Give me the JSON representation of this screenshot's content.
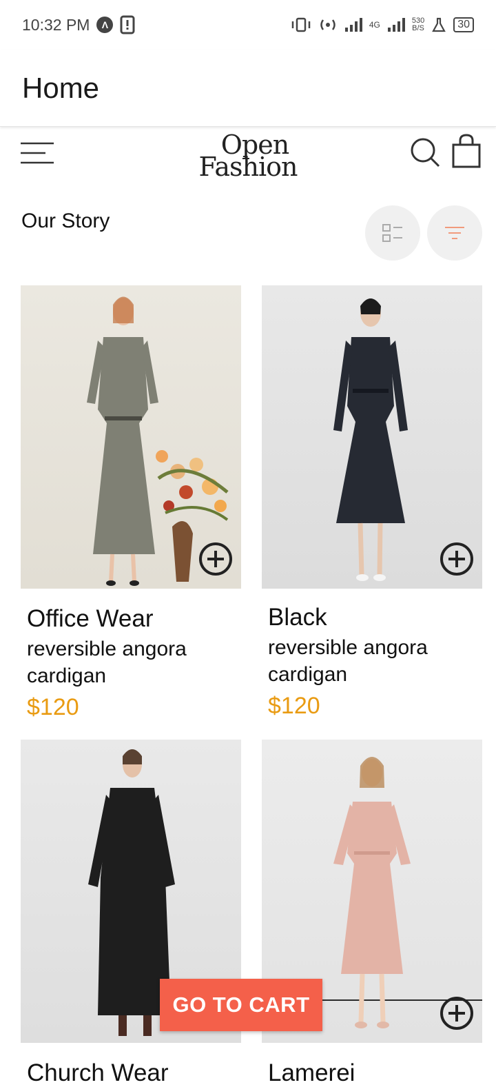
{
  "status_bar": {
    "time": "10:32 PM",
    "network_speed_value": "530",
    "network_speed_unit": "B/S",
    "network_type": "4G",
    "battery": "30"
  },
  "app_bar": {
    "title": "Home"
  },
  "header": {
    "logo_line1": "Open",
    "logo_line2": "Fashion"
  },
  "section": {
    "title": "Our Story"
  },
  "products": [
    {
      "name": "Office Wear",
      "description": "reversible angora cardigan",
      "price": "$120"
    },
    {
      "name": "Black",
      "description": "reversible angora cardigan",
      "price": "$120"
    },
    {
      "name": "Church Wear",
      "description": "",
      "price": ""
    },
    {
      "name": "Lamerei",
      "description": "",
      "price": ""
    }
  ],
  "cart_button": {
    "label": "GO TO CART"
  },
  "colors": {
    "accent": "#f4604a",
    "price": "#e99b12",
    "filter_icon": "#f19a7c"
  }
}
